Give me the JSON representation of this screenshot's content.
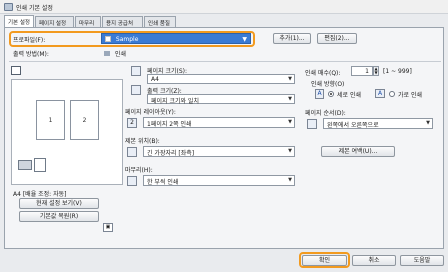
{
  "window": {
    "title": "인쇄 기본 설정"
  },
  "tabs": [
    "기본 설정",
    "페이지 설정",
    "마무리",
    "용지 공급처",
    "인쇄 품질"
  ],
  "profile": {
    "label": "프로파일(F):",
    "value": "Sample",
    "add_label": "추가(1)...",
    "edit_label": "편집(2)..."
  },
  "output": {
    "label": "출력 방법(M):",
    "value": "인쇄"
  },
  "preview": {
    "page_labels": [
      "1",
      "2"
    ],
    "caption": "A4 [배율 조정: 자동]",
    "view_settings_label": "현재 설정 보기(V)",
    "restore_defaults_label": "기본값 복원(R)"
  },
  "paper": {
    "size_label": "페이지 크기(S):",
    "size_value": "A4",
    "output_size_label": "출력 크기(Z):",
    "output_size_value": "페이지 크기와 일치",
    "layout_label": "페이지 레이아웃(Y):",
    "layout_value": "1페이지 2쪽 인쇄",
    "binding_label": "제본 위치(B):",
    "binding_value": "긴 가장자리 [좌측]",
    "duplex_label": "마무리(H):",
    "duplex_value": "한 부씩 인쇄"
  },
  "copies": {
    "label": "인쇄 매수(Q):",
    "value": "1",
    "range": "[1 ~ 999]"
  },
  "orientation": {
    "label": "인쇄 방향(O)",
    "portrait_label": "세로 인쇄",
    "landscape_label": "가로 인쇄"
  },
  "page_order": {
    "label": "페이지 순서(D):",
    "value": "왼쪽에서 오른쪽으로"
  },
  "binding_margin_label": "제본 여백(U)...",
  "footer": {
    "ok_label": "확인",
    "cancel_label": "취소",
    "help_label": "도움말"
  }
}
